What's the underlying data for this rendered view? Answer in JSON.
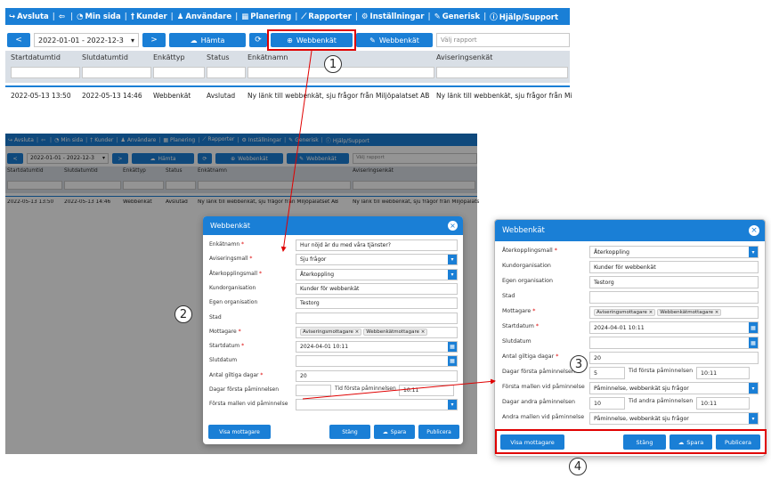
{
  "nav": {
    "items": [
      {
        "icon": "logout-icon",
        "glyph": "↪",
        "label": "Avsluta"
      },
      {
        "icon": "back-arrow-icon",
        "glyph": "⇦",
        "label": ""
      },
      {
        "icon": "gauge-icon",
        "glyph": "◔",
        "label": "Min sida"
      },
      {
        "icon": "person-up-icon",
        "glyph": "†",
        "label": "Kunder"
      },
      {
        "icon": "users-icon",
        "glyph": "♟",
        "label": "Användare"
      },
      {
        "icon": "calendar-icon",
        "glyph": "▦",
        "label": "Planering"
      },
      {
        "icon": "chart-icon",
        "glyph": "⟋",
        "label": "Rapporter"
      },
      {
        "icon": "gears-icon",
        "glyph": "⚙",
        "label": "Inställningar"
      },
      {
        "icon": "wrench-icon",
        "glyph": "✎",
        "label": "Generisk"
      },
      {
        "icon": "info-icon",
        "glyph": "ⓘ",
        "label": "Hjälp/Support"
      }
    ]
  },
  "toolbar": {
    "prev": "<",
    "date_range": "2022-01-01 - 2022-12-3",
    "next": ">",
    "fetch": "Hämta",
    "refresh": "⟳",
    "new_survey": "Webbenkät",
    "edit_survey": "Webbenkät",
    "report_placeholder": "Välj rapport"
  },
  "table": {
    "headers": [
      "Startdatumtid",
      "Slutdatumtid",
      "Enkättyp",
      "Status",
      "Enkätnamn",
      "Aviseringsenkät"
    ],
    "rows": [
      [
        "2022-05-13 13:50",
        "2022-05-13 14:46",
        "Webbenkät",
        "Avslutad",
        "Ny länk till webbenkät, sju frågor från Miljöpalatset AB",
        "Ny länk till webbenkät, sju frågor från Miljöpalatset AB"
      ]
    ]
  },
  "modal": {
    "title": "Webbenkät",
    "close": "×",
    "labels": {
      "enkatnamn": "Enkätnamn",
      "aviseringsmall": "Aviseringsmall",
      "aterkopplingsmall": "Återkopplingsmall",
      "kundorganisation": "Kundorganisation",
      "egen_organisation": "Egen organisation",
      "stad": "Stad",
      "mottagare": "Mottagare",
      "startdatum": "Startdatum",
      "slutdatum": "Slutdatum",
      "antal_dagar": "Antal giltiga dagar",
      "dagar_forsta": "Dagar första påminnelsen",
      "tid_forsta": "Tid första påminnelsen",
      "forsta_mallen": "Första mallen vid påminnelse",
      "dagar_andra": "Dagar andra påminnelsen",
      "tid_andra": "Tid andra påminnelsen",
      "andra_mallen": "Andra mallen vid påminnelse"
    },
    "values": {
      "enkatnamn": "Hur nöjd är du med våra tjänster?",
      "aviseringsmall": "Sju frågor",
      "aterkopplingsmall": "Återkoppling",
      "kundorganisation": "Kunder för webbenkät",
      "egen_organisation": "Testorg",
      "stad": "",
      "mottagare_chips": [
        "Aviseringsmottagare ×",
        "Webbenkätmottagare ×"
      ],
      "startdatum": "2024-04-01 10:11",
      "slutdatum": "",
      "antal_dagar": "20",
      "dagar_forsta": "",
      "tid_forsta": "10:11",
      "forsta_mallen": "",
      "dagar_forsta_right": "5",
      "forsta_mallen_right": "Påminnelse, webbenkät sju frågor",
      "dagar_andra": "10",
      "tid_andra": "10:11",
      "andra_mallen": "Påminnelse, webbenkät sju frågor"
    },
    "buttons": {
      "show_recipients": "Visa mottagare",
      "close": "Stäng",
      "save": "Spara",
      "publish": "Publicera"
    }
  },
  "callouts": [
    "1",
    "2",
    "3",
    "4"
  ],
  "colors": {
    "primary": "#1a7fd6",
    "header_bg": "#d9dfe6",
    "highlight": "#e00000"
  }
}
